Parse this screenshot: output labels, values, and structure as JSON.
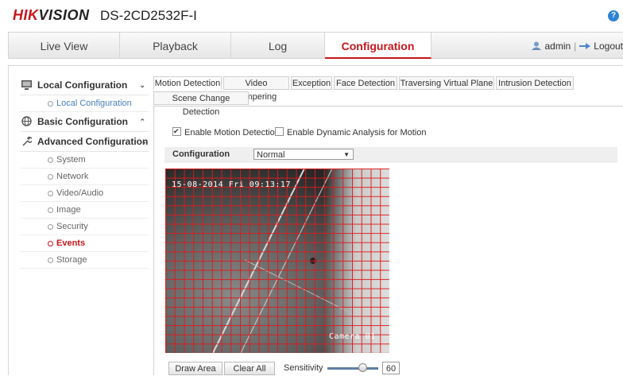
{
  "header": {
    "brand_red": "HIK",
    "brand_dark": "VISION",
    "model": "DS-2CD2532F-I",
    "help_icon": "?"
  },
  "nav": {
    "tabs": [
      {
        "label": "Live View"
      },
      {
        "label": "Playback"
      },
      {
        "label": "Log"
      },
      {
        "label": "Configuration",
        "active": true
      }
    ],
    "user": "admin",
    "separator": "|",
    "logout": "Logout",
    "accent": "#c4161c"
  },
  "sidebar": {
    "groups": [
      {
        "label": "Local Configuration",
        "chevron": "⌄",
        "items": [
          "Local Configuration"
        ]
      },
      {
        "label": "Basic Configuration",
        "chevron": "⌃"
      },
      {
        "label": "Advanced Configuration",
        "chevron": "⌄",
        "items": [
          "System",
          "Network",
          "Video/Audio",
          "Image",
          "Security",
          "Events",
          "Storage"
        ],
        "active_item": "Events"
      }
    ]
  },
  "content": {
    "tabs": [
      "Motion Detection",
      "Video Tampering",
      "Exception",
      "Face Detection",
      "Traversing Virtual Plane",
      "Intrusion Detection",
      "Scene Change Detection"
    ],
    "active_tab": "Motion Detection",
    "enable_motion": {
      "label": "Enable Motion Detection",
      "checked": true
    },
    "enable_dynamic": {
      "label": "Enable Dynamic Analysis for Motion",
      "checked": false
    },
    "config_label": "Configuration",
    "config_value": "Normal",
    "osd_time": "15-08-2014 Fri 09:13:17",
    "osd_camera": "Camera 01",
    "draw_area": "Draw Area",
    "clear_all": "Clear All",
    "sensitivity_label": "Sensitivity",
    "sensitivity_value": "60"
  }
}
